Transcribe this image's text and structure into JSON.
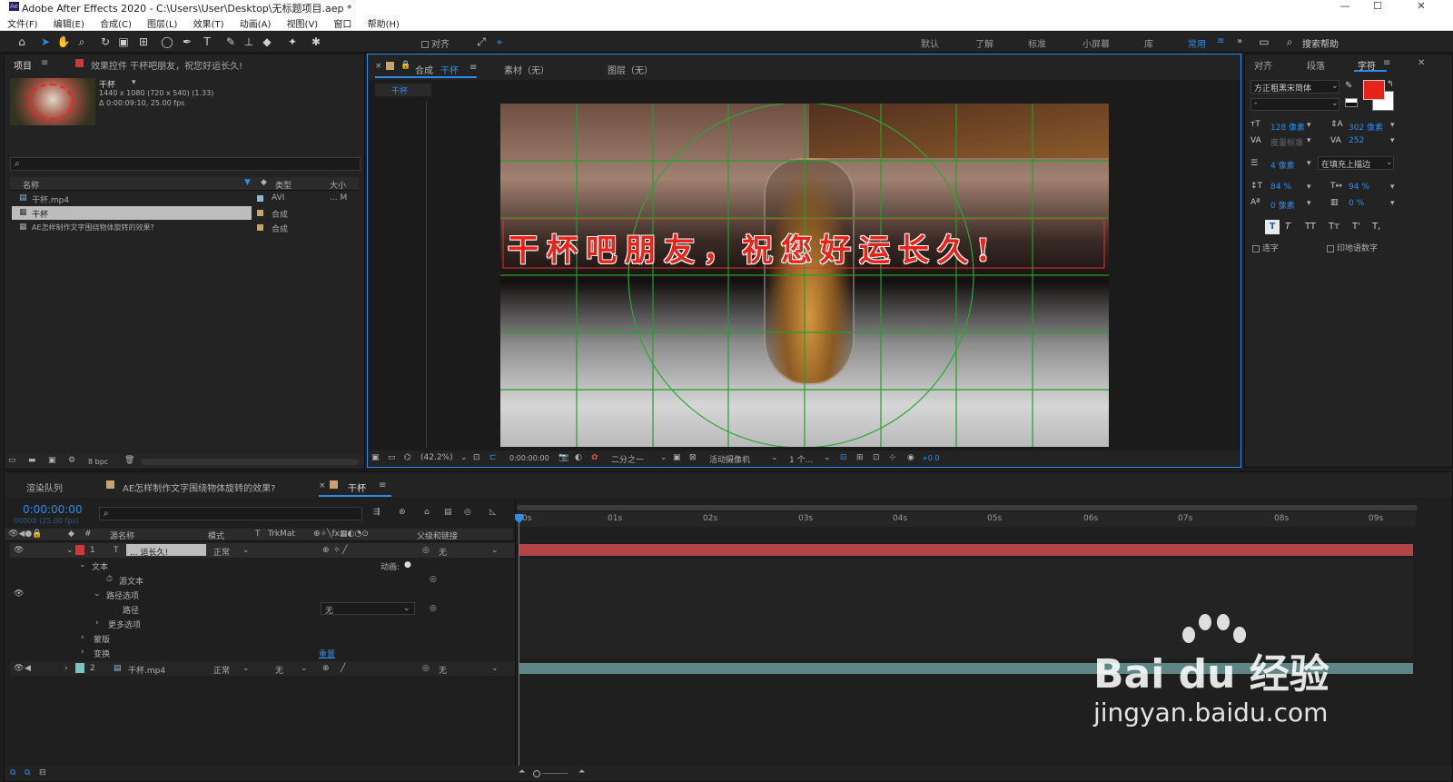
{
  "window": {
    "app_icon": "Ae",
    "title": "Adobe After Effects 2020 - C:\\Users\\User\\Desktop\\无标题项目.aep *",
    "min": "—",
    "max": "☐",
    "close": "✕"
  },
  "menu": [
    "文件(F)",
    "编辑(E)",
    "合成(C)",
    "图层(L)",
    "效果(T)",
    "动画(A)",
    "视图(V)",
    "窗口",
    "帮助(H)"
  ],
  "toolbar": {
    "align_label": "对齐",
    "workspaces": [
      "默认",
      "了解",
      "标准",
      "小屏幕",
      "库",
      "常用"
    ],
    "active_workspace": "常用",
    "overflow": "»",
    "search_placeholder": "搜索帮助"
  },
  "project_panel": {
    "tab_project": "项目",
    "tab_effects": "效果控件 干杯吧朋友，祝您好运长久!",
    "item_name": "干杯",
    "item_dims": "1440 x 1080  (720 x 540) (1.33)",
    "item_duration": "Δ 0:00:09:10, 25.00 fps",
    "col_name": "名称",
    "col_type": "类型",
    "col_size": "大小",
    "items": [
      {
        "name": "干杯.mp4",
        "type": "AVI",
        "size": "... M",
        "color": "#8fb8d8"
      },
      {
        "name": "干杯",
        "type": "合成",
        "size": "",
        "color": "#c9a36a"
      },
      {
        "name": "AE怎样制作文字围绕物体旋转的效果?",
        "type": "合成",
        "size": "",
        "color": "#c9a36a"
      }
    ],
    "bpc": "8 bpc"
  },
  "comp_panel": {
    "tab_comp_prefix": "合成",
    "tab_comp_name": "干杯",
    "tab_footage": "素材（无）",
    "tab_layer": "图层（无）",
    "breadcrumb": "干杯",
    "overlay_text": "干杯吧朋友，祝您好运长久!",
    "zoom": "(42.2%)",
    "timecode": "0:00:00:00",
    "resolution": "二分之一",
    "camera": "活动摄像机",
    "views": "1 个...",
    "exposure": "+0.0"
  },
  "character_panel": {
    "tab_align": "对齐",
    "tab_paragraph": "段落",
    "tab_character": "字符",
    "font": "方正粗黑宋简体",
    "style": "-",
    "size": "128 像素",
    "leading": "302 像素",
    "kerning": "度量标准",
    "tracking": "252",
    "stroke": "4 像素",
    "stroke_mode": "在填充上描边",
    "vscale": "84 %",
    "hscale": "94 %",
    "baseline": "0 像素",
    "tsume": "0 %",
    "style_buttons": [
      "T",
      "T",
      "TT",
      "Tт",
      "T'",
      "T,"
    ],
    "ligatures": "连字",
    "hindi_digits": "印地语数字",
    "fill_color": "#e8231a",
    "stroke_color": "#ffffff"
  },
  "timeline": {
    "tab_render": "渲染队列",
    "tab_comp1": "AE怎样制作文字围绕物体旋转的效果?",
    "tab_comp2": "干杯",
    "timecode": "0:00:00:00",
    "fps": "00000 (25.00 fps)",
    "col_source": "源名称",
    "col_mode": "模式",
    "col_t": "T",
    "col_trkmat": "TrkMat",
    "col_parent": "父级和链接",
    "ruler": [
      "0s",
      "01s",
      "02s",
      "03s",
      "04s",
      "05s",
      "06s",
      "07s",
      "08s",
      "09s"
    ],
    "layer1": {
      "num": "1",
      "name": "... 运长久!",
      "mode": "正常",
      "parent": "无",
      "color": "#d0393b"
    },
    "text_group": "文本",
    "animate": "动画:",
    "source_text": "源文本",
    "path_options": "路径选项",
    "path": "路径",
    "path_value": "无",
    "more_options": "更多选项",
    "masks": "蒙版",
    "transform": "变换",
    "reset": "重置",
    "layer2": {
      "num": "2",
      "name": "干杯.mp4",
      "mode": "正常",
      "trkmat": "无",
      "parent": "无",
      "color": "#7ec3c3"
    }
  },
  "watermark": {
    "brand": "Bai du 经验",
    "url": "jingyan.baidu.com"
  }
}
